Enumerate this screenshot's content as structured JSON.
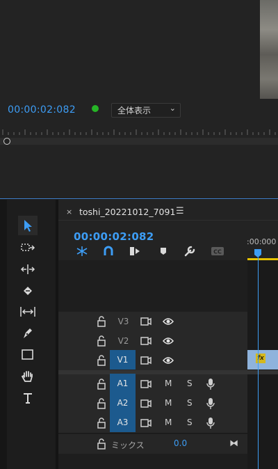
{
  "program_monitor": {
    "timecode": "00:00:02:082",
    "fit_select": {
      "value": "全体表示",
      "chevron": "⌄"
    }
  },
  "timeline": {
    "close": "×",
    "sequence_name": "toshi_20221012_7091",
    "menu": "☰",
    "timecode": "00:00:02:082",
    "ruler_time": ":00:000",
    "video_tracks": [
      {
        "label": "V3",
        "selected": false
      },
      {
        "label": "V2",
        "selected": false
      },
      {
        "label": "V1",
        "selected": true
      }
    ],
    "audio_tracks": [
      {
        "label": "A1",
        "m": "M",
        "s": "S"
      },
      {
        "label": "A2",
        "m": "M",
        "s": "S"
      },
      {
        "label": "A3",
        "m": "M",
        "s": "S"
      }
    ],
    "mix": {
      "label": "ミックス",
      "value": "0.0",
      "icon": "⧓"
    },
    "clip_badge": "fx"
  },
  "tools": [
    "selection-tool",
    "track-select-tool",
    "ripple-edit-tool",
    "razor-tool",
    "slip-tool",
    "pen-tool",
    "rectangle-tool",
    "hand-tool",
    "type-tool"
  ],
  "colors": {
    "accent": "#3d9df5",
    "selected_track": "#1c5a8e",
    "clip": "#8fb3dc",
    "fx": "#d5b81c",
    "green": "#26b526",
    "work_area": "#e6c200"
  }
}
